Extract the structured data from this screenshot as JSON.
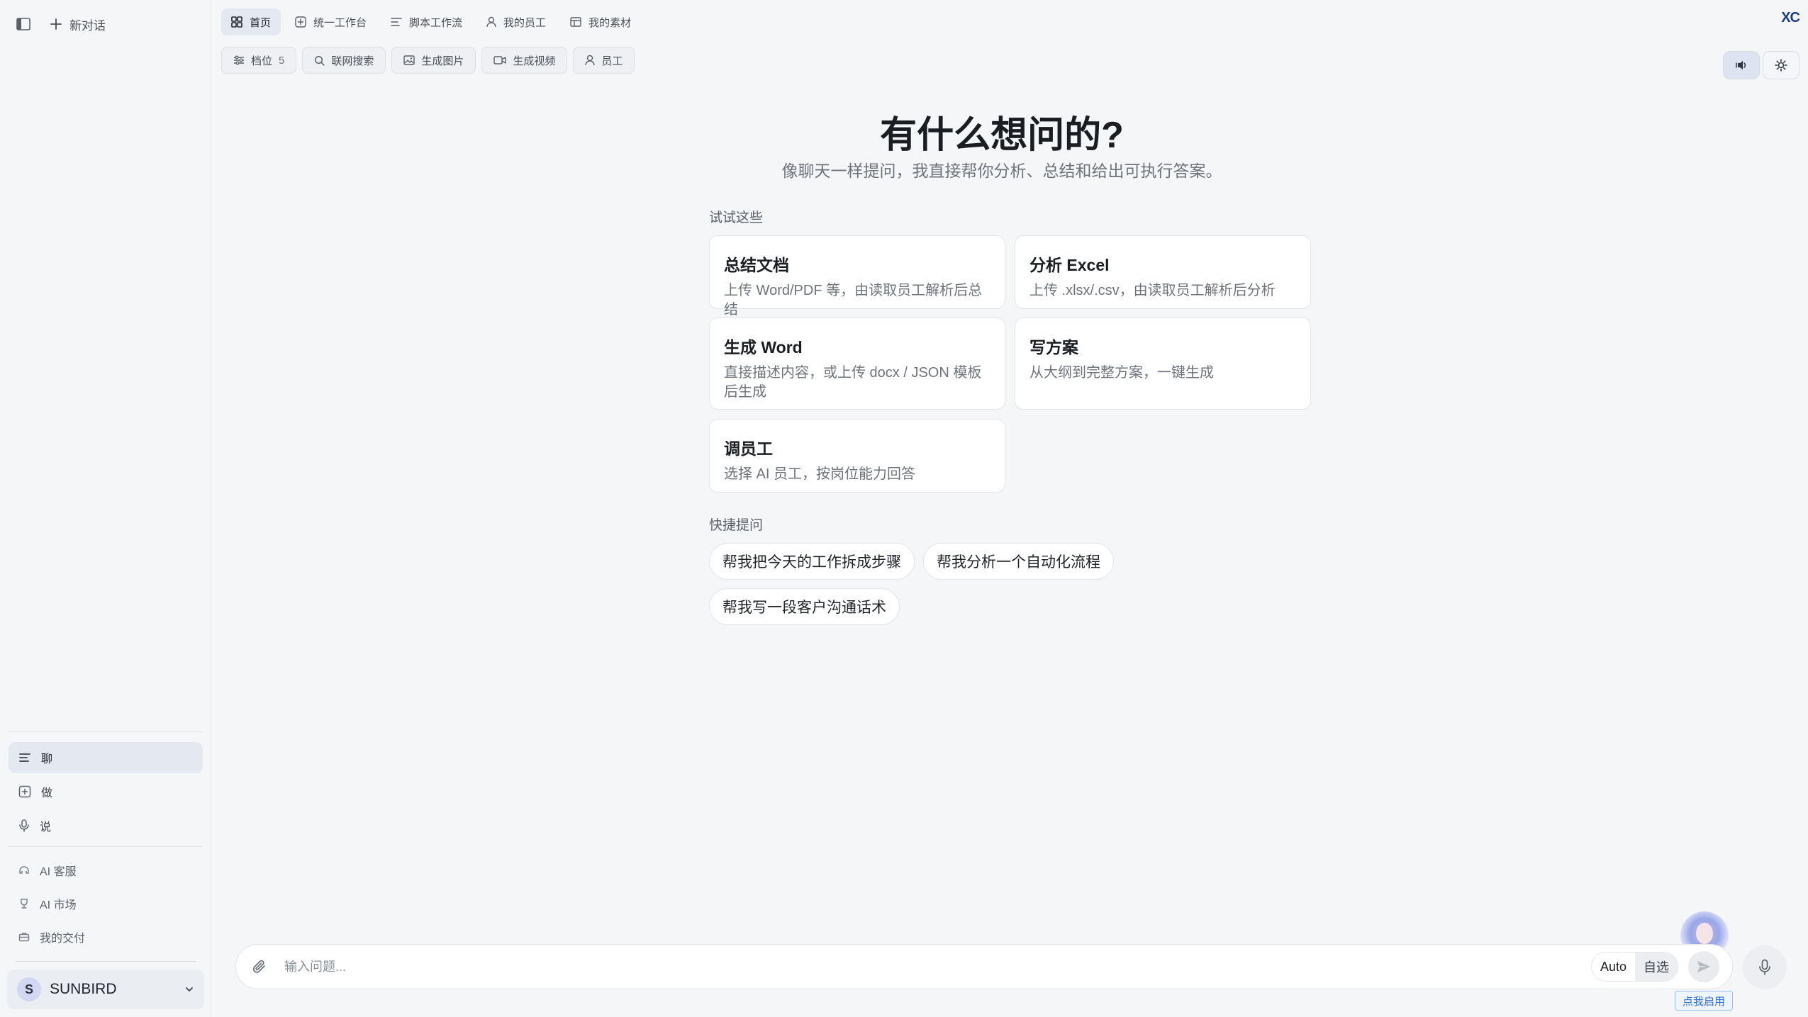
{
  "sidebar": {
    "new_chat_label": "新对话",
    "nav": [
      {
        "label": "聊",
        "icon": "chat-lines-icon",
        "active": true
      },
      {
        "label": "做",
        "icon": "plus-square-icon",
        "active": false
      },
      {
        "label": "说",
        "icon": "microphone-icon",
        "active": false
      }
    ],
    "secondary": [
      {
        "label": "AI 客服",
        "icon": "headset-icon"
      },
      {
        "label": "AI 市场",
        "icon": "trophy-icon"
      },
      {
        "label": "我的交付",
        "icon": "briefcase-icon"
      }
    ],
    "user": {
      "initial": "S",
      "name": "SUNBIRD"
    }
  },
  "topnav": {
    "tabs": [
      {
        "label": "首页",
        "icon": "grid-icon",
        "active": true
      },
      {
        "label": "统一工作台",
        "icon": "plus-square-icon",
        "active": false
      },
      {
        "label": "脚本工作流",
        "icon": "lines-icon",
        "active": false
      },
      {
        "label": "我的员工",
        "icon": "person-icon",
        "active": false
      },
      {
        "label": "我的素材",
        "icon": "layout-icon",
        "active": false
      }
    ],
    "brand": "XC"
  },
  "toolbar": {
    "level_label": "档位",
    "level_value": "5",
    "chips": [
      {
        "label": "联网搜索",
        "icon": "search-icon"
      },
      {
        "label": "生成图片",
        "icon": "image-icon"
      },
      {
        "label": "生成视频",
        "icon": "video-icon"
      },
      {
        "label": "员工",
        "icon": "person-icon"
      }
    ]
  },
  "hero": {
    "title": "有什么想问的?",
    "subtitle": "像聊天一样提问，我直接帮你分析、总结和给出可执行答案。"
  },
  "suggestions": {
    "label": "试试这些",
    "cards": [
      {
        "title": "总结文档",
        "desc": "上传 Word/PDF 等，由读取员工解析后总结"
      },
      {
        "title": "分析 Excel",
        "desc": "上传 .xlsx/.csv，由读取员工解析后分析"
      },
      {
        "title": "生成 Word",
        "desc": "直接描述内容，或上传 docx / JSON 模板后生成"
      },
      {
        "title": "写方案",
        "desc": "从大纲到完整方案，一键生成"
      },
      {
        "title": "调员工",
        "desc": "选择 AI 员工，按岗位能力回答"
      }
    ]
  },
  "quick": {
    "label": "快捷提问",
    "items": [
      "帮我把今天的工作拆成步骤",
      "帮我分析一个自动化流程",
      "帮我写一段客户沟通话术"
    ]
  },
  "composer": {
    "placeholder": "输入问题...",
    "mode_auto": "Auto",
    "mode_custom": "自选",
    "enable_tip": "点我启用"
  }
}
